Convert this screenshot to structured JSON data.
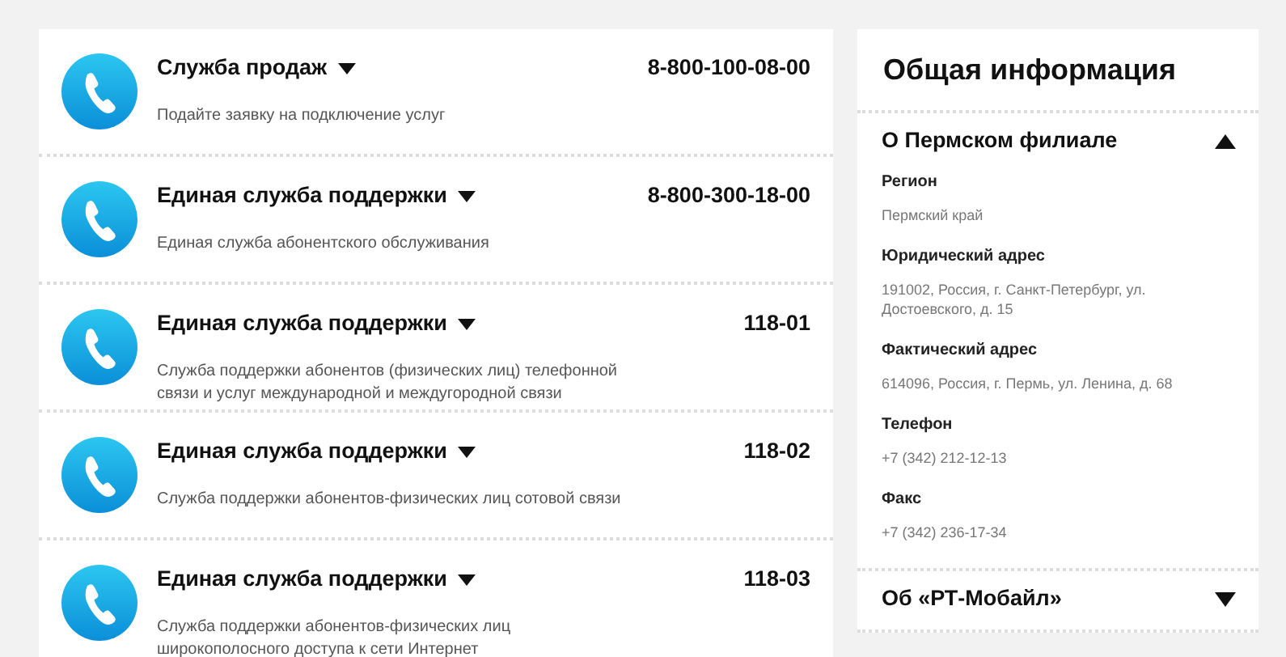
{
  "contacts": [
    {
      "title": "Служба продаж",
      "number": "8-800-100-08-00",
      "description": "Подайте заявку на подключение услуг"
    },
    {
      "title": "Единая служба поддержки",
      "number": "8-800-300-18-00",
      "description": "Единая служба абонентского обслуживания"
    },
    {
      "title": "Единая служба поддержки",
      "number": "118-01",
      "description": "Служба поддержки абонентов (физических лиц) телефонной связи и услуг международной и междугородной связи"
    },
    {
      "title": "Единая служба поддержки",
      "number": "118-02",
      "description": "Служба поддержки абонентов-физических лиц сотовой связи"
    },
    {
      "title": "Единая служба поддержки",
      "number": "118-03",
      "description": "Служба поддержки абонентов-физических лиц широкополосного доступа к сети Интернет"
    }
  ],
  "info": {
    "title": "Общая информация",
    "sections": [
      {
        "title": "О Пермском филиале",
        "expanded": true,
        "fields": [
          {
            "label": "Регион",
            "value": "Пермский край"
          },
          {
            "label": "Юридический адрес",
            "value": "191002, Россия, г. Санкт-Петербург, ул. Достоевского, д. 15"
          },
          {
            "label": "Фактический адрес",
            "value": "614096, Россия, г. Пермь, ул. Ленина, д. 68"
          },
          {
            "label": "Телефон",
            "value": "+7 (342) 212-12-13"
          },
          {
            "label": "Факс",
            "value": "+7 (342) 236-17-34"
          }
        ]
      },
      {
        "title": "Об «РТ-Мобайл»",
        "expanded": false
      }
    ]
  }
}
